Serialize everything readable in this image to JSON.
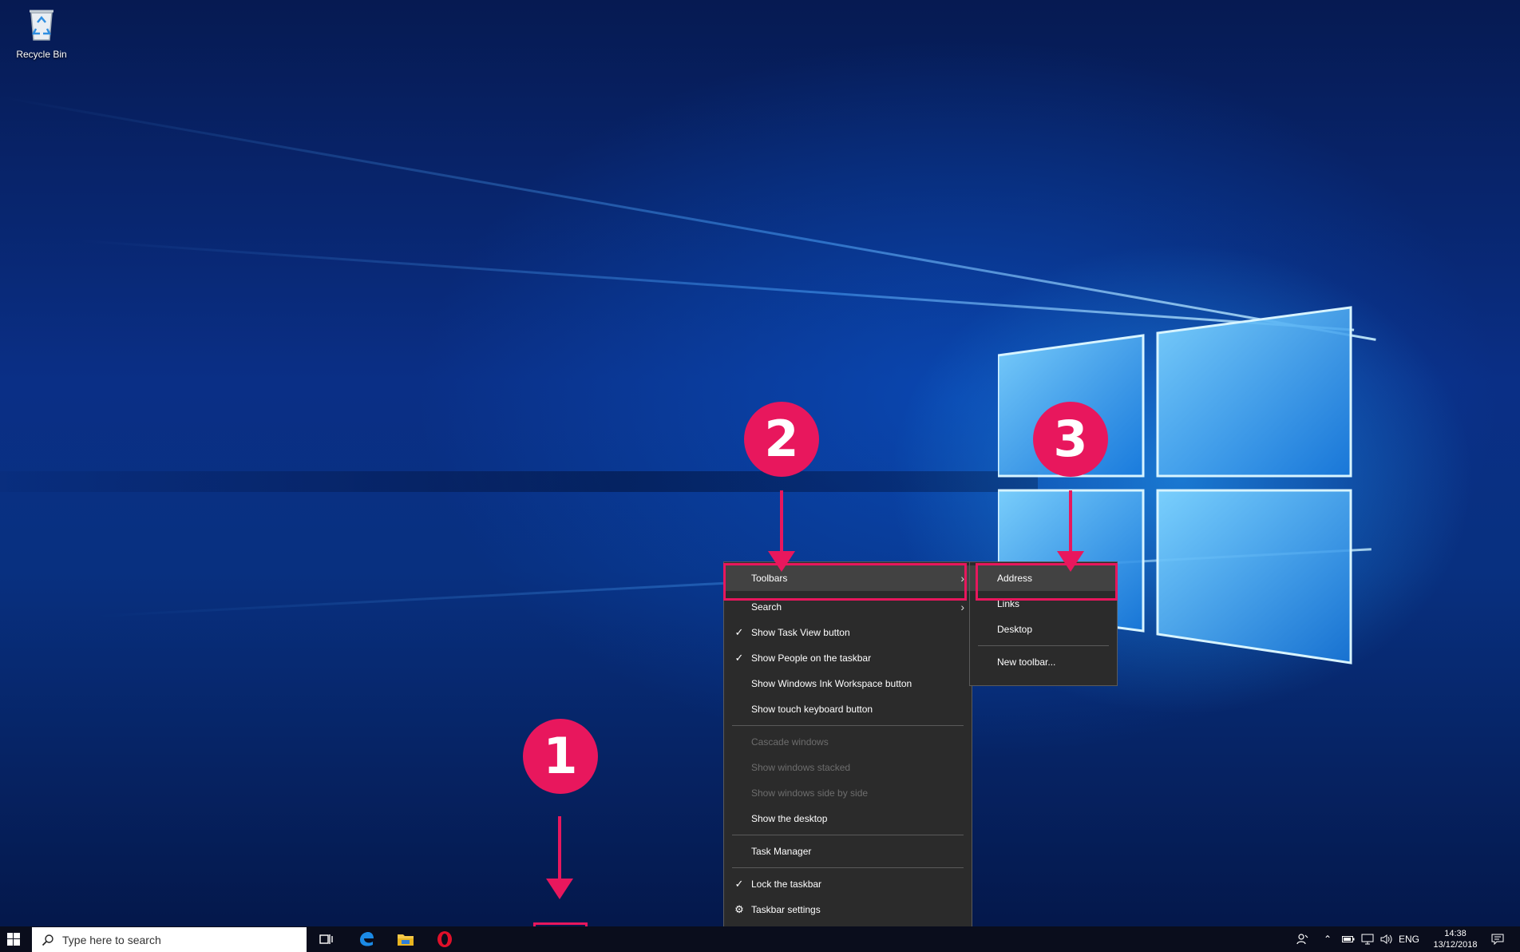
{
  "desktop": {
    "icons": [
      {
        "label": "Recycle Bin",
        "icon": "recycle-bin-icon"
      }
    ]
  },
  "context_menu": {
    "items": [
      {
        "label": "Toolbars",
        "checked": false,
        "submenu": true,
        "disabled": false,
        "highlighted": true
      },
      {
        "label": "Search",
        "checked": false,
        "submenu": true,
        "disabled": false
      },
      {
        "label": "Show Task View button",
        "checked": true,
        "disabled": false
      },
      {
        "label": "Show People on the taskbar",
        "checked": true,
        "disabled": false
      },
      {
        "label": "Show Windows Ink Workspace button",
        "checked": false,
        "disabled": false
      },
      {
        "label": "Show touch keyboard button",
        "checked": false,
        "disabled": false
      },
      {
        "label": "Cascade windows",
        "disabled": true
      },
      {
        "label": "Show windows stacked",
        "disabled": true
      },
      {
        "label": "Show windows side by side",
        "disabled": true
      },
      {
        "label": "Show the desktop",
        "disabled": false
      },
      {
        "label": "Task Manager",
        "disabled": false
      },
      {
        "label": "Lock the taskbar",
        "checked": true,
        "disabled": false
      },
      {
        "label": "Taskbar settings",
        "icon": "gear-icon",
        "disabled": false
      }
    ]
  },
  "toolbars_submenu": {
    "items": [
      {
        "label": "Address",
        "highlighted": true
      },
      {
        "label": "Links"
      },
      {
        "label": "Desktop"
      },
      {
        "label": "New toolbar..."
      }
    ]
  },
  "annotations": {
    "step1": "1",
    "step2": "2",
    "step3": "3",
    "color": "#e8175d"
  },
  "taskbar": {
    "search_placeholder": "Type here to search",
    "pinned": [
      "task-view-icon",
      "edge-icon",
      "file-explorer-icon",
      "opera-icon"
    ],
    "tray": {
      "language": "ENG",
      "time": "14:38",
      "date": "13/12/2018"
    }
  }
}
